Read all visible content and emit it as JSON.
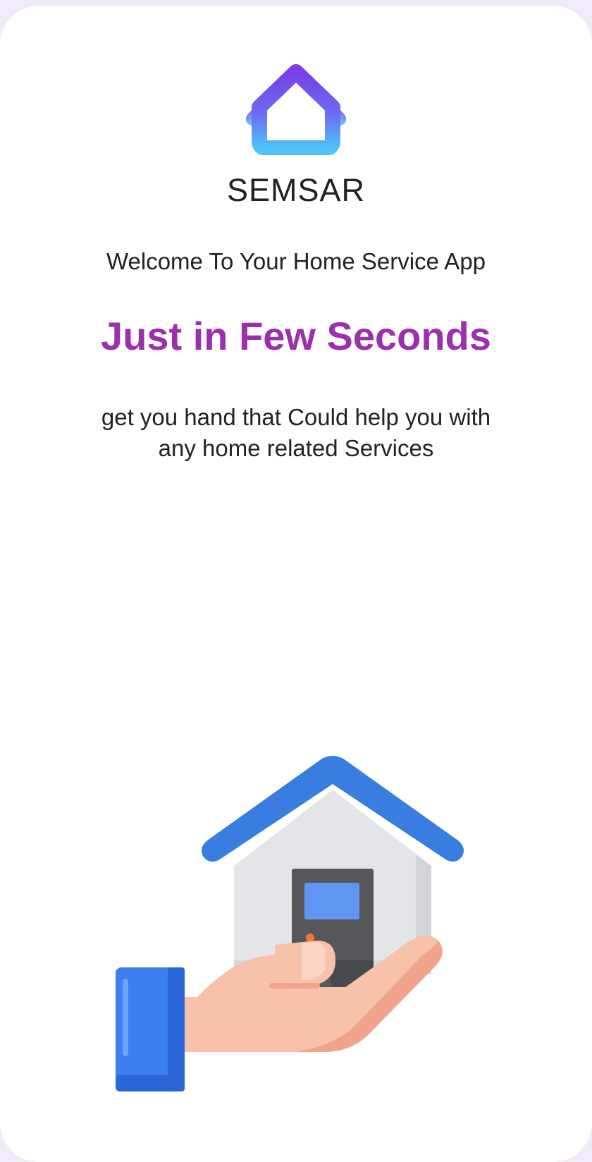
{
  "app": {
    "name": "SEMSAR",
    "logo_icon": "house-outline-logo-icon"
  },
  "welcome": {
    "text": "Welcome To Your Home Service App"
  },
  "headline": {
    "text": "Just in Few Seconds"
  },
  "description": {
    "text": "get you hand that Could help you with any home related Services"
  },
  "illustration": {
    "icon": "hand-holding-house-icon"
  },
  "colors": {
    "background": "#ffffff",
    "outer": "#f1eaf8",
    "headline": "#9b2fae",
    "text": "#222222",
    "logo_gradient_top": "#7b3fe4",
    "logo_gradient_bottom": "#4fc3f7",
    "roof_blue": "#3a7de0",
    "wall_gray": "#e4e5e8",
    "door_dark": "#56575b",
    "hand_skin": "#f8c2aa",
    "sleeve_blue": "#3d7ff0"
  }
}
